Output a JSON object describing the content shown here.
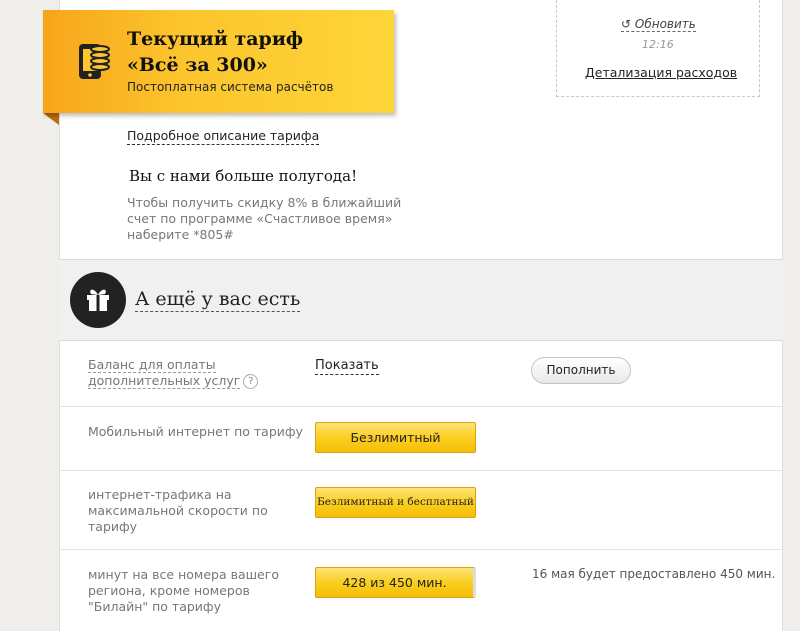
{
  "tariff": {
    "title_line1": "Текущий тариф",
    "title_line2": "«Всё за 300»",
    "subtitle": "Постоплатная система расчётов",
    "description_link": "Подробное описание тарифа"
  },
  "loyalty": {
    "title": "Вы с нами больше полугода!",
    "text": "Чтобы получить скидку 8% в ближайший счет по программе «Счастливое время» наберите *805#"
  },
  "balance_box": {
    "refresh_label": "Обновить",
    "time": "12:16",
    "details_link": "Детализация расходов"
  },
  "extras": {
    "title": "А ещё у вас есть",
    "rows": [
      {
        "label": "Баланс для оплаты дополнительных услуг",
        "action": "Показать",
        "button": "Пополнить"
      },
      {
        "label": "Мобильный интернет по тарифу",
        "value": "Безлимитный"
      },
      {
        "label": "интернет-трафика на максимальной скорости по тарифу",
        "value": "Безлимитный и бесплатный"
      },
      {
        "label": "минут на все номера вашего региона, кроме номеров \"Билайн\" по тарифу",
        "value": "428 из 450 мин.",
        "note": "16 мая будет предоставлено 450 мин."
      }
    ]
  },
  "colors": {
    "brand_yellow": "#fcc52c",
    "brand_orange": "#f7a51b",
    "dark": "#222222"
  },
  "icons": [
    "phone-coins-icon",
    "refresh-icon",
    "gift-icon",
    "help-icon"
  ]
}
